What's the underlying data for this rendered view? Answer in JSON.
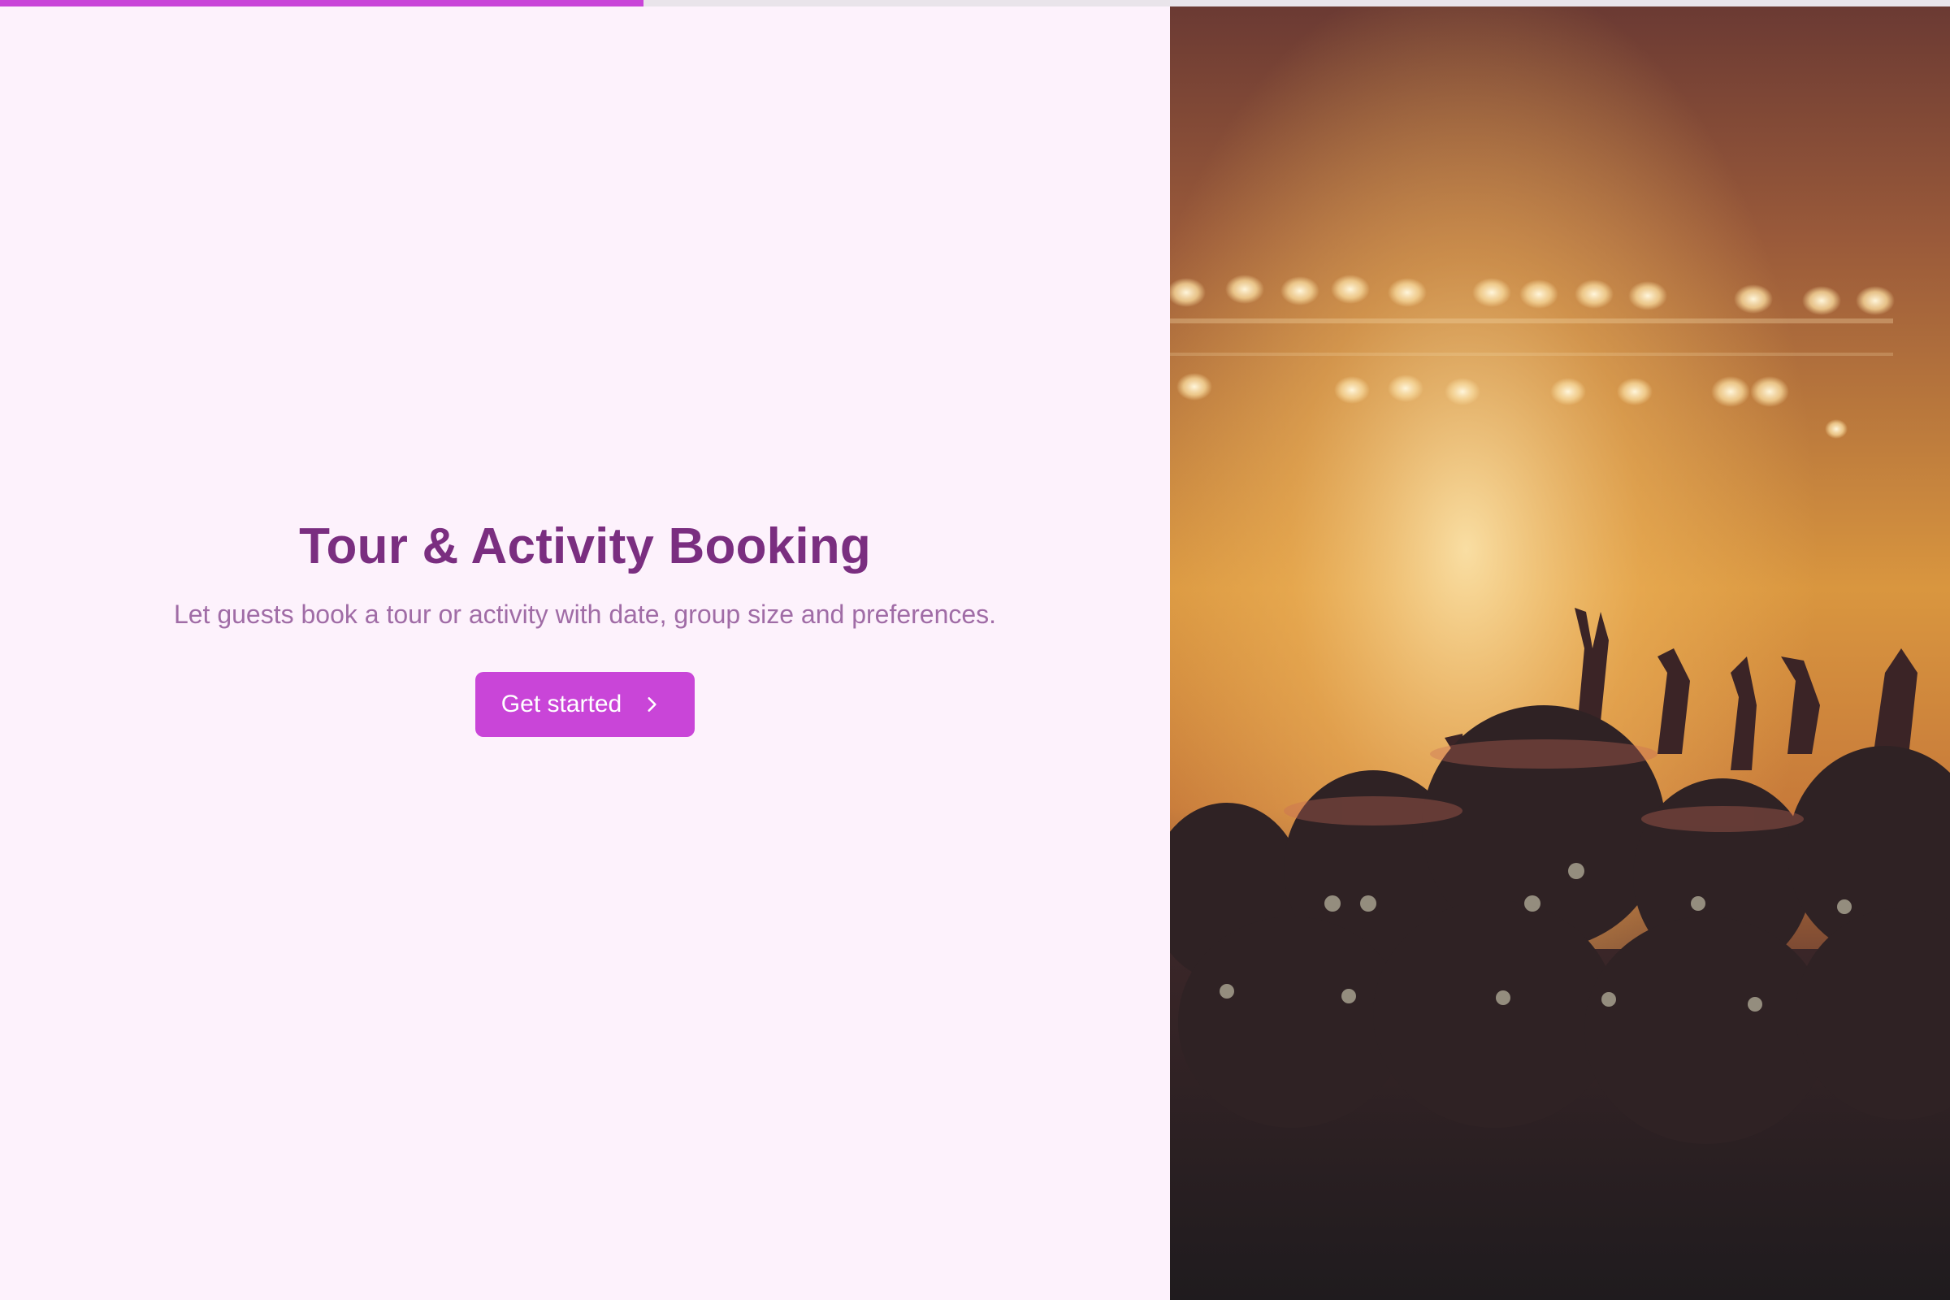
{
  "progress": {
    "value": 0.33,
    "color": "#c945d8"
  },
  "hero": {
    "title": "Tour & Activity Booking",
    "subtitle": "Let guests book a tour or activity with date, group size and preferences.",
    "cta_label": "Get started",
    "cta_icon": "chevron-right-icon"
  },
  "image": {
    "subject": "concert-crowd-photo"
  },
  "colors": {
    "accent": "#c945d8",
    "title": "#7a2e80",
    "subtitle": "#a06ca6",
    "background": "#fdf2fc"
  }
}
